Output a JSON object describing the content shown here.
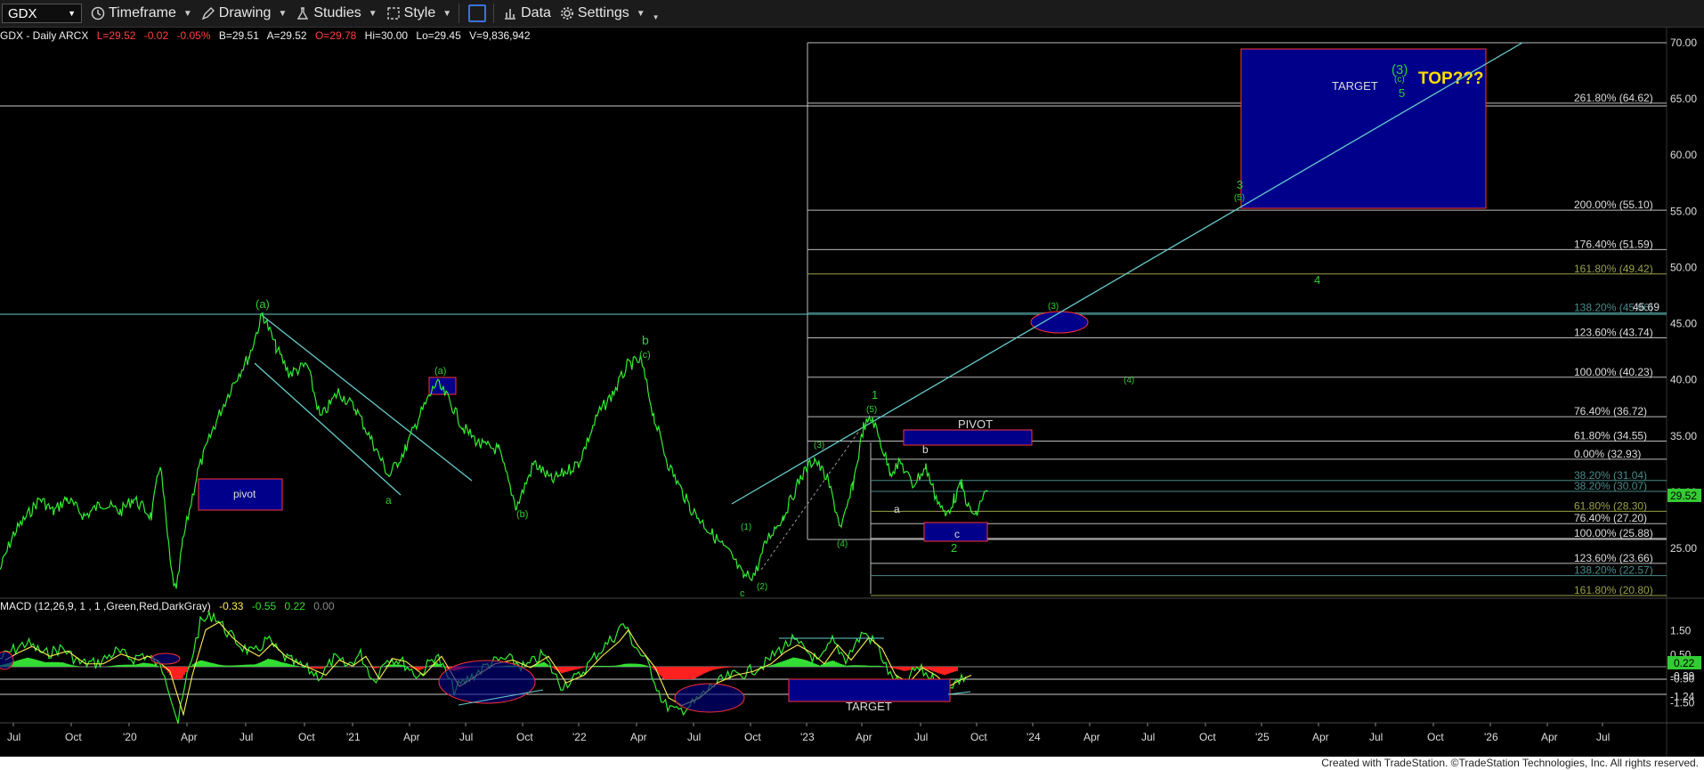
{
  "toolbar": {
    "symbol": "GDX",
    "timeframe": "Timeframe",
    "drawing": "Drawing",
    "studies": "Studies",
    "style": "Style",
    "data": "Data",
    "settings": "Settings"
  },
  "info": {
    "series": "GDX - Daily  ARCX",
    "last": "L=29.52",
    "change": "-0.02",
    "pct": "-0.05%",
    "bid": "B=29.51",
    "ask": "A=29.52",
    "open": "O=29.78",
    "high": "Hi=30.00",
    "low": "Lo=29.45",
    "volume": "V=9,836,942"
  },
  "macd": {
    "label": "MACD (12,26,9, 1 , 1 ,Green,Red,DarkGray)",
    "v1": "-0.33",
    "v2": "-0.55",
    "v3": "0.22",
    "v4": "0.00"
  },
  "colors": {
    "up": "#33dd33",
    "down": "#ff2020",
    "box": "#00008b",
    "level": "#cfcfcf",
    "wave": "#33cc33"
  },
  "price_axis": [
    "70.00",
    "65.00",
    "60.00",
    "55.00",
    "50.00",
    "45.00",
    "40.00",
    "35.00",
    "30.00",
    "25.00"
  ],
  "price_flags": {
    "last": "29.52",
    "level": "45.69"
  },
  "macd_axis": [
    "1.50",
    "0.50",
    "-0.39",
    "-0.50",
    "-1.24",
    "-1.50"
  ],
  "macd_flag": "0.22",
  "x_axis": [
    "Jul",
    "Oct",
    "'20",
    "Apr",
    "Jul",
    "Oct",
    "'21",
    "Apr",
    "Jul",
    "Oct",
    "'22",
    "Apr",
    "Jul",
    "Oct",
    "'23",
    "Apr",
    "Jul",
    "Oct",
    "'24",
    "Apr",
    "Jul",
    "Oct",
    "'25",
    "Apr",
    "Jul",
    "Oct",
    "'26",
    "Apr",
    "Jul"
  ],
  "fib_labels": [
    "261.80% (64.62)",
    "200.00% (55.10)",
    "176.40% (51.59)",
    "161.80% (49.42)",
    "138.20% (45.96)",
    "123.60% (43.74)",
    "100.00% (40.23)",
    "76.40% (36.72)",
    "61.80% (34.55)",
    "0.00% (32.93)",
    "38.20% (31.04)",
    "38.20% (30.07)",
    "61.80% (28.30)",
    "76.40% (27.20)",
    "100.00% (25.88)",
    "123.60% (23.66)",
    "138.20% (22.57)",
    "161.80% (20.80)"
  ],
  "boxes": {
    "target": "TARGET",
    "pivot_left": "pivot",
    "pivot_right": "PIVOT",
    "macd_target": "TARGET",
    "top": "TOP???"
  },
  "waves": {
    "a_top": "(a)",
    "a_low": "a",
    "a_mid": "(a)",
    "b_small": "(b)",
    "b_big": "b",
    "c_big": "(c)",
    "c_low": "c",
    "w1": "(1)",
    "w2": "(2)",
    "w3": "(3)",
    "w4": "(4)",
    "w5": "(5)",
    "one": "1",
    "a2": "a",
    "b2": "b",
    "c2": "c",
    "two": "2",
    "three": "3",
    "five3": "(5)",
    "three_paren": "(3)",
    "four_paren": "(4)",
    "four": "4",
    "big3": "(3)",
    "c_top": "(c)",
    "five": "5"
  },
  "footer": "Created with TradeStation. ©TradeStation Technologies, Inc. All rights reserved."
}
